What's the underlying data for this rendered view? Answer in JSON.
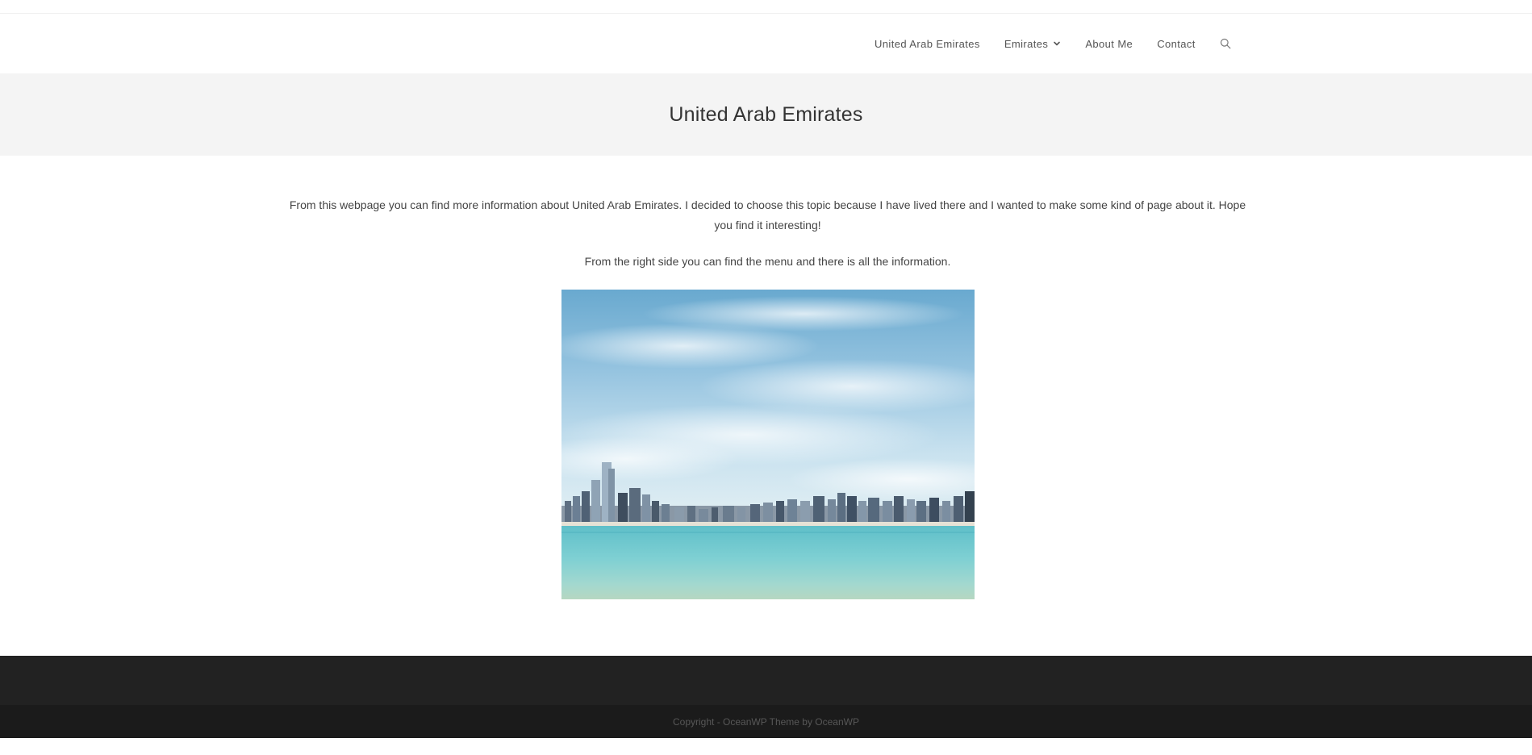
{
  "nav": {
    "items": [
      {
        "label": "United Arab Emirates"
      },
      {
        "label": "Emirates"
      },
      {
        "label": "About Me"
      },
      {
        "label": "Contact"
      }
    ]
  },
  "page_title": "United Arab Emirates",
  "content": {
    "paragraph_1": "From this webpage you can find more information about United Arab Emirates. I decided to choose this topic because I have lived there and I wanted to make some kind of page about it. Hope you find it interesting!",
    "paragraph_2": "From the right side you can find the menu and there is all the information."
  },
  "footer": {
    "copyright": "Copyright - OceanWP Theme by OceanWP"
  },
  "icons": {
    "search": "search-icon",
    "dropdown": "chevron-down-icon"
  },
  "colors": {
    "title_bar_bg": "#f4f4f4",
    "footer_bg": "#222222",
    "footer_bottom_bg": "#1b1b1b"
  }
}
